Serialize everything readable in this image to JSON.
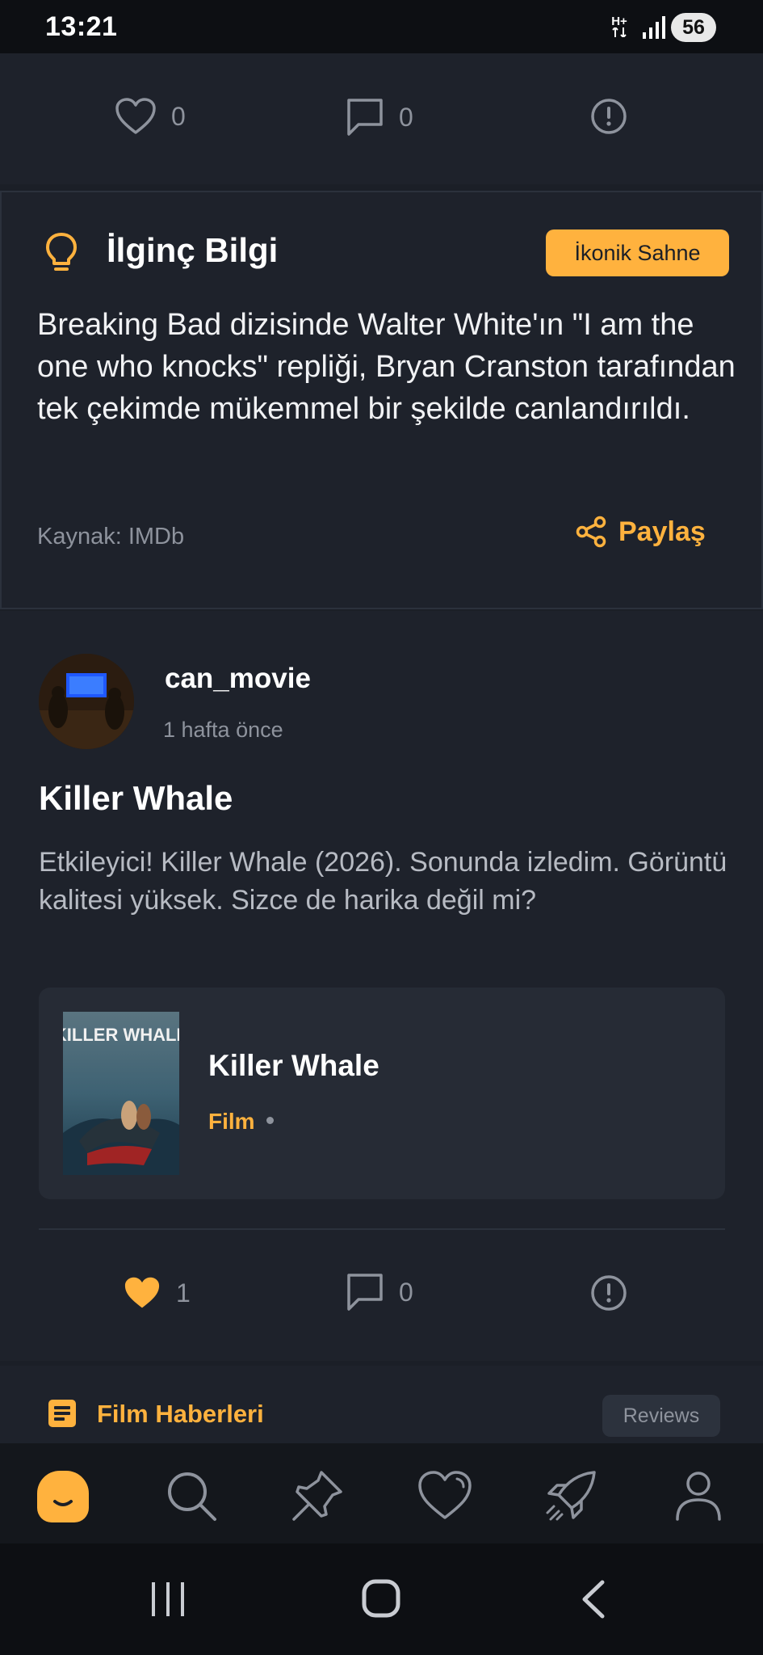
{
  "status_bar": {
    "time": "13:21",
    "network": "H+",
    "battery": "56"
  },
  "previous_post_actions": {
    "likes": "0",
    "comments": "0"
  },
  "fun_fact": {
    "title": "İlginç Bilgi",
    "badge": "İkonik Sahne",
    "text": "Breaking Bad dizisinde Walter White'ın \"I am the one who knocks\" repliği, Bryan Cranston tarafından tek çekimde mükemmel bir şekilde canlandırıldı.",
    "source": "Kaynak: IMDb",
    "share_label": "Paylaş"
  },
  "post": {
    "username": "can_movie",
    "time_ago": "1 hafta önce",
    "title": "Killer Whale",
    "body": "Etkileyici! Killer Whale (2026). Sonunda izledim. Görüntü kalitesi yüksek. Sizce de harika değil mi?",
    "movie": {
      "poster_text": "KILLER WHALE",
      "name": "Killer Whale",
      "type": "Film"
    },
    "likes": "1",
    "comments": "0"
  },
  "news": {
    "title": "Film Haberleri",
    "tag": "Reviews"
  },
  "colors": {
    "accent": "#ffb23e",
    "background": "#1b1f27",
    "card": "#1e222b",
    "muted_text": "#8e939d"
  },
  "bottom_nav": [
    "home-icon",
    "search-icon",
    "pin-icon",
    "heart-icon",
    "rocket-icon",
    "profile-icon"
  ],
  "system_nav": [
    "recents-icon",
    "home-circle-icon",
    "back-icon"
  ]
}
